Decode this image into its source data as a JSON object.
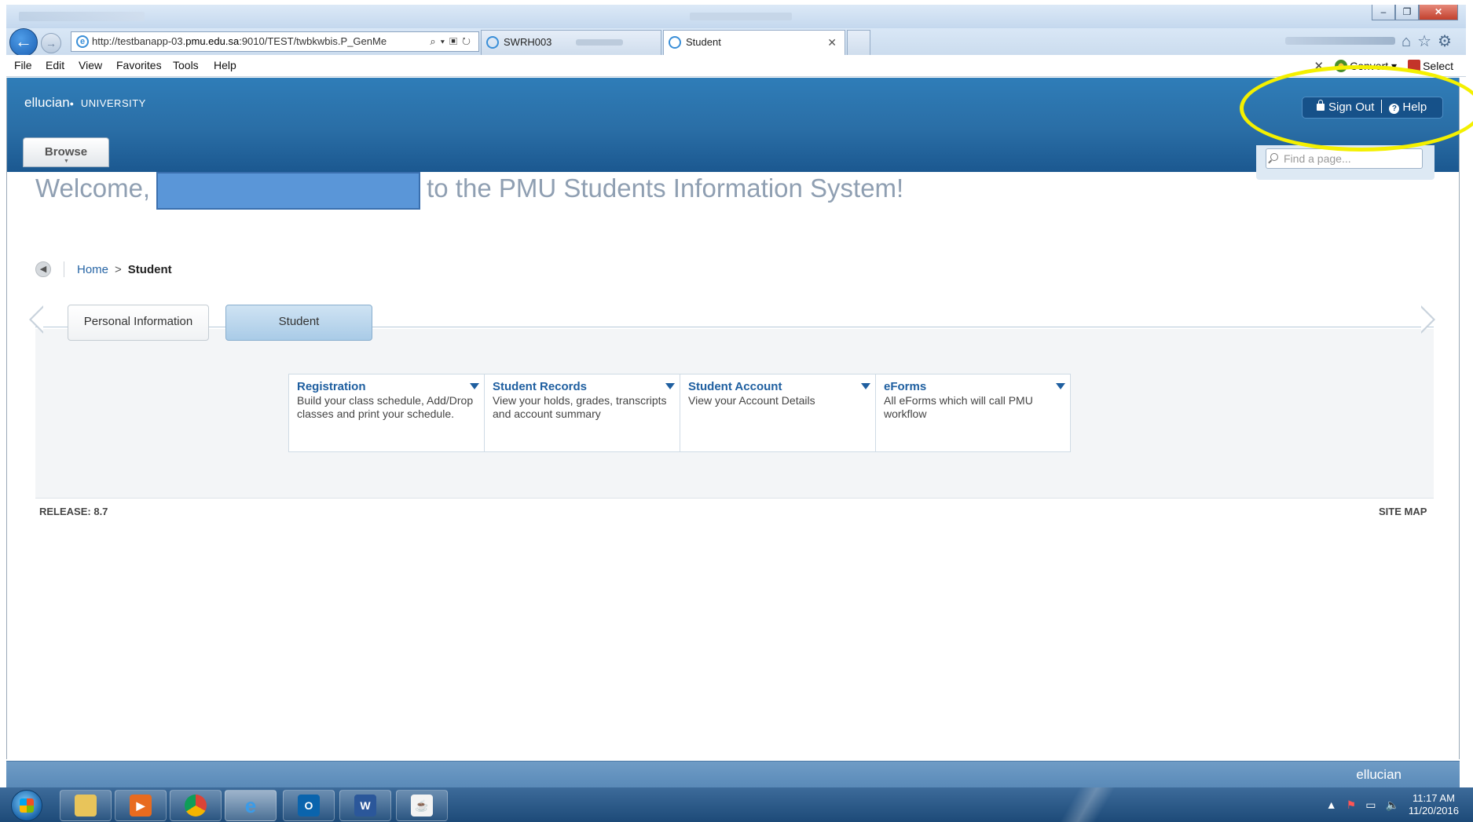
{
  "browser": {
    "address_prefix": "http://testbanapp-03.",
    "address_domain": "pmu.edu.sa",
    "address_suffix": ":9010/TEST/twbkwbis.P_GenMe",
    "tabs": [
      {
        "label": "SWRH003"
      },
      {
        "label": "Student"
      }
    ],
    "menu": [
      "File",
      "Edit",
      "View",
      "Favorites",
      "Tools",
      "Help"
    ],
    "convert_label": "Convert",
    "select_label": "Select"
  },
  "header": {
    "brand": "ellucian",
    "brand_sub": "UNIVERSITY",
    "browse_label": "Browse",
    "signout_label": "Sign Out",
    "help_label": "Help",
    "find_placeholder": "Find a page...",
    "highlight_color": "#f4f000"
  },
  "welcome": {
    "prefix": "Welcome,",
    "suffix": "to the PMU Students Information System!"
  },
  "breadcrumb": {
    "home": "Home",
    "separator": ">",
    "current": "Student"
  },
  "tabs": [
    {
      "label": "Personal Information"
    },
    {
      "label": "Student",
      "active": true
    }
  ],
  "cards": [
    {
      "title": "Registration",
      "desc": "Build your class schedule, Add/Drop classes and print your schedule."
    },
    {
      "title": "Student Records",
      "desc": "View your holds, grades, transcripts and account summary"
    },
    {
      "title": "Student Account",
      "desc": "View your Account Details"
    },
    {
      "title": "eForms",
      "desc": "All eForms which will call PMU workflow"
    }
  ],
  "footer": {
    "release": "RELEASE: 8.7",
    "site_map": "SITE MAP",
    "brand": "ellucian"
  },
  "taskbar": {
    "time": "11:17 AM",
    "date": "11/20/2016"
  }
}
